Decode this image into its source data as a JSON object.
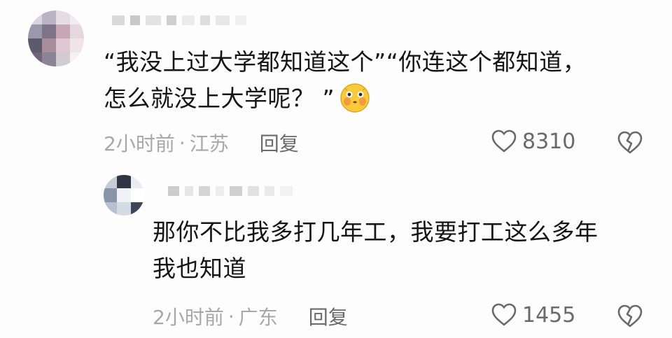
{
  "comment": {
    "text_line1": "“我没上过大学都知道这个”“你连这个都知道，",
    "text_line2": "怎么就没上大学呢？ ”",
    "emoji": "thinking-cheeks-emoji",
    "time": "2小时前",
    "separator": "·",
    "location": "江苏",
    "reply_label": "回复",
    "likes": "8310"
  },
  "reply": {
    "text_line1": "那你不比我多打几年工，我要打工这么多年",
    "text_line2": "我也知道",
    "time": "2小时前",
    "separator": "·",
    "location": "广东",
    "reply_label": "回复",
    "likes": "1455"
  },
  "icons": {
    "like": "heart-outline-icon",
    "dislike": "broken-heart-icon"
  },
  "colors": {
    "background": "#fdfdfd",
    "text": "#151515",
    "meta": "#a8a8a8",
    "action": "#6a6a6a"
  }
}
